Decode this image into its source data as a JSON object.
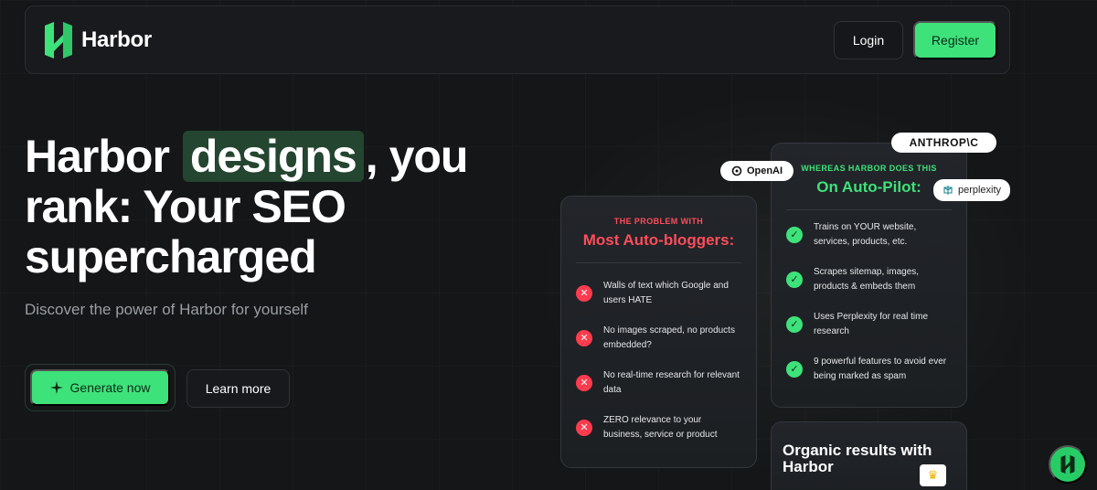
{
  "brand": {
    "name": "Harbor",
    "accent": "#3ee27a"
  },
  "nav": {
    "login_label": "Login",
    "register_label": "Register"
  },
  "hero": {
    "title_prefix": "Harbor",
    "title_highlight": "designs",
    "title_suffix": ", you rank: Your SEO supercharged",
    "subtitle": "Discover the power of Harbor for yourself",
    "primary_label": "Generate now",
    "secondary_label": "Learn more"
  },
  "problem_card": {
    "kicker": "THE PROBLEM WITH",
    "title": "Most Auto-bloggers:",
    "items": [
      "Walls of text which Google and users HATE",
      "No images scraped, no products embedded?",
      "No real-time research for relevant data",
      "ZERO relevance to your business, service or product"
    ]
  },
  "harbor_card": {
    "kicker": "WHEREAS HARBOR DOES THIS",
    "title": "On Auto-Pilot:",
    "items": [
      "Trains on YOUR website, services, products, etc.",
      "Scrapes sitemap, images, products & embeds them",
      "Uses Perplexity for real time research",
      "9 powerful features to avoid ever being marked as spam"
    ]
  },
  "organic_card": {
    "title": "Organic results with Harbor"
  },
  "badges": {
    "anthropic": "ANTHROP\\C",
    "openai": "OpenAI",
    "perplexity": "perplexity"
  },
  "icons": {
    "x": "close-icon",
    "check": "check-icon",
    "sparkle": "sparkle-icon",
    "crown": "crown-icon"
  }
}
